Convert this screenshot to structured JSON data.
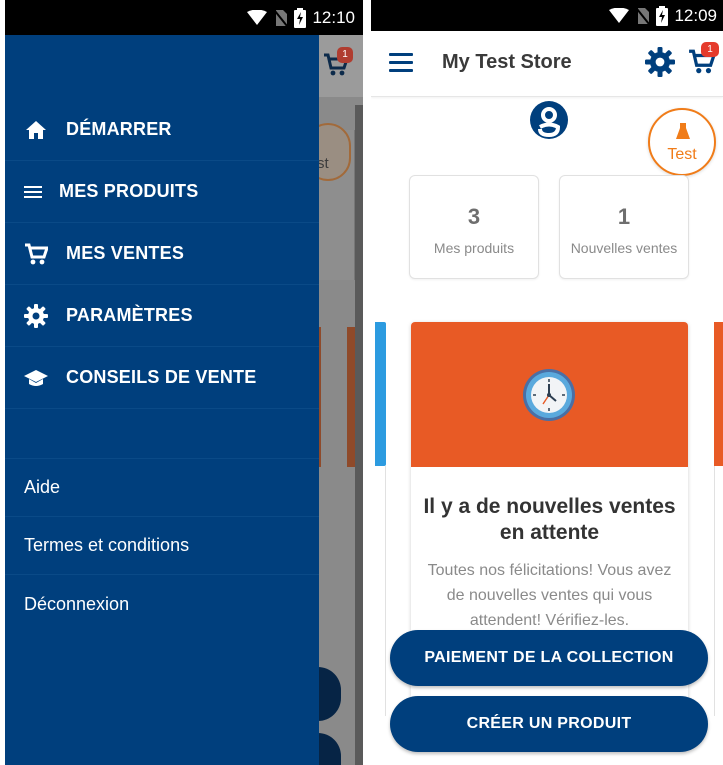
{
  "colors": {
    "primary": "#003f7d",
    "accent_orange": "#e85a25",
    "test_orange": "#f07c19",
    "badge_red": "#e53b2c",
    "card_blue": "#2c9be0"
  },
  "left_screen": {
    "status": {
      "time": "12:10"
    },
    "cart_badge": "1",
    "test_label_partial": "st",
    "drawer": {
      "menu_items": [
        {
          "icon": "home-icon",
          "label": "DÉMARRER"
        },
        {
          "icon": "list-icon",
          "label": "MES PRODUITS"
        },
        {
          "icon": "cart-icon",
          "label": "MES VENTES"
        },
        {
          "icon": "gear-icon",
          "label": "PARAMÈTRES"
        },
        {
          "icon": "graduation-cap-icon",
          "label": "CONSEILS DE VENTE"
        }
      ],
      "links": [
        {
          "label": "Aide"
        },
        {
          "label": "Termes et conditions"
        },
        {
          "label": "Déconnexion"
        }
      ]
    }
  },
  "right_screen": {
    "status": {
      "time": "12:09"
    },
    "header": {
      "title": "My Test Store",
      "cart_badge": "1"
    },
    "test_badge": "Test",
    "stats": [
      {
        "value": "3",
        "label": "Mes produits"
      },
      {
        "value": "1",
        "label": "Nouvelles ventes"
      }
    ],
    "promo": {
      "icon": "clock-icon",
      "title": "Il y a de nouvelles ventes en attente",
      "body": "Toutes nos félicitations! Vous avez de nouvelles ventes qui vous attendent! Vérifiez-les."
    },
    "buttons": {
      "collection_payment": "PAIEMENT DE LA COLLECTION",
      "create_product": "CRÉER UN PRODUIT"
    }
  }
}
